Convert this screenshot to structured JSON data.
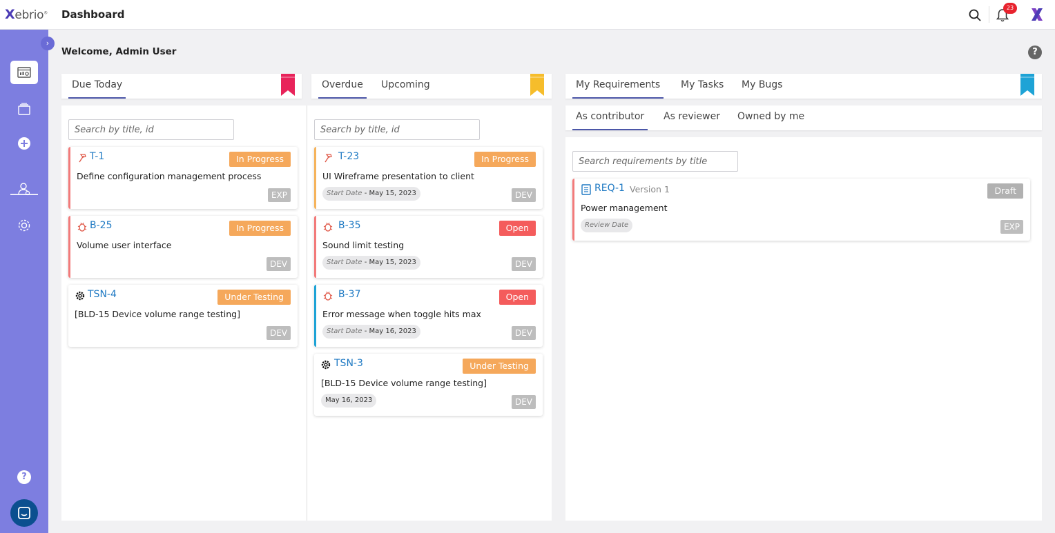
{
  "app": {
    "logo_text": "ebrio",
    "page_title": "Dashboard",
    "notification_count": "23"
  },
  "welcome": "Welcome, Admin User",
  "colors": {
    "sidebar": "#7d7ee0",
    "accent_link": "#1e79c3",
    "in_progress": "#f5a85b",
    "open": "#f45c5c",
    "draft": "#b1b1b1",
    "ribbon_red": "#e8235a",
    "ribbon_yellow": "#f6bd2b",
    "ribbon_blue": "#1ea3d6"
  },
  "sidebar": {
    "items": [
      "dashboard-icon",
      "projects-icon",
      "add-icon",
      "users-icon",
      "settings-icon"
    ],
    "help": "?"
  },
  "due_today": {
    "tab": "Due Today",
    "search_placeholder": "Search by title, id",
    "cards": [
      {
        "id": "T-1",
        "title": "Define configuration management process",
        "status": "In Progress",
        "env": "EXP",
        "icon": "hammer-icon"
      },
      {
        "id": "B-25",
        "title": "Volume user interface",
        "status": "In Progress",
        "env": "DEV",
        "icon": "bug-icon"
      },
      {
        "id": "TSN-4",
        "title": "[BLD-15 Device volume range testing]",
        "status": "Under Testing",
        "env": "DEV",
        "icon": "test-gear-icon"
      }
    ]
  },
  "overdue": {
    "tabs": [
      "Overdue",
      "Upcoming"
    ],
    "search_placeholder": "Search by title, id",
    "cards": [
      {
        "id": "T-23",
        "title": "UI Wireframe presentation to client",
        "status": "In Progress",
        "env": "DEV",
        "date_label": "Start Date",
        "date": "May 15, 2023",
        "icon": "hammer-icon"
      },
      {
        "id": "B-35",
        "title": "Sound limit testing",
        "status": "Open",
        "env": "DEV",
        "date_label": "Start Date",
        "date": "May 15, 2023",
        "icon": "bug-icon"
      },
      {
        "id": "B-37",
        "title": "Error message when toggle hits max",
        "status": "Open",
        "env": "DEV",
        "date_label": "Start Date",
        "date": "May 16, 2023",
        "icon": "bug-icon"
      },
      {
        "id": "TSN-3",
        "title": "[BLD-15 Device volume range testing]",
        "status": "Under Testing",
        "env": "DEV",
        "date": "May 16, 2023",
        "icon": "test-gear-icon"
      }
    ]
  },
  "requirements": {
    "tabs": [
      "My Requirements",
      "My Tasks",
      "My Bugs"
    ],
    "subtabs": [
      "As contributor",
      "As reviewer",
      "Owned by me"
    ],
    "search_placeholder": "Search requirements by title",
    "cards": [
      {
        "id": "REQ-1",
        "version": "Version 1",
        "title": "Power management",
        "status": "Draft",
        "env": "EXP",
        "date_label": "Review Date",
        "icon": "document-icon"
      }
    ]
  }
}
